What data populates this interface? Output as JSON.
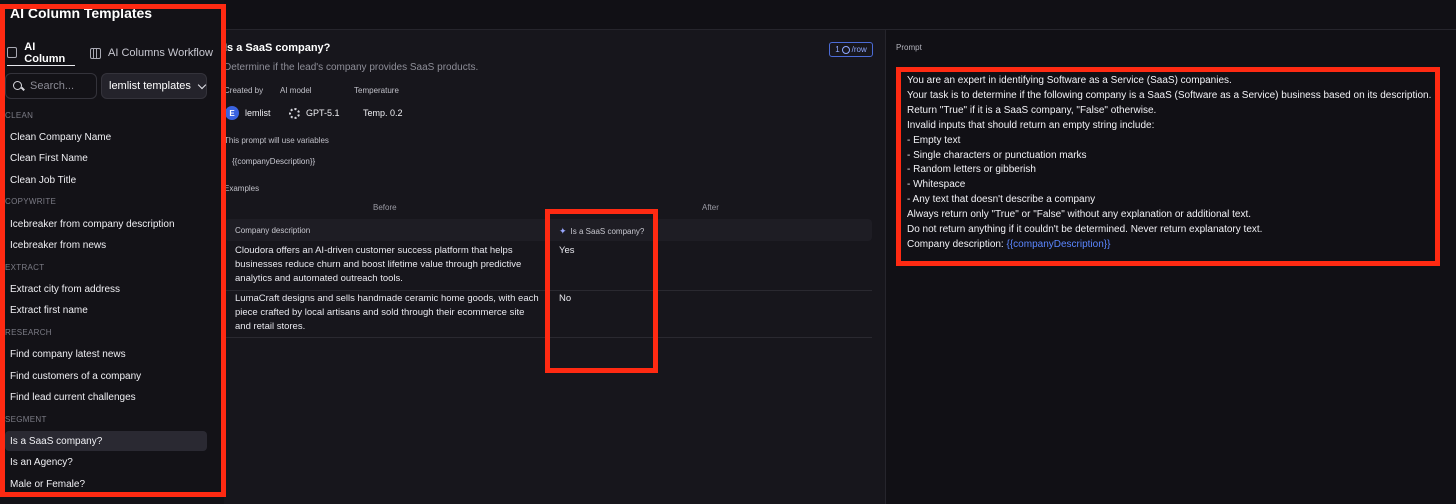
{
  "sidebar": {
    "title": "AI Column Templates",
    "tabs": [
      {
        "label": "AI Column",
        "icon": "document-icon",
        "active": true
      },
      {
        "label": "AI Columns Workflow",
        "icon": "columns-icon",
        "active": false
      }
    ],
    "search": {
      "placeholder": "Search...",
      "value": ""
    },
    "template_select": {
      "value": "lemlist templates"
    },
    "sections": [
      {
        "name": "CLEAN",
        "items": [
          "Clean Company Name",
          "Clean First Name",
          "Clean Job Title"
        ]
      },
      {
        "name": "COPYWRITE",
        "items": [
          "Icebreaker from company description",
          "Icebreaker from news"
        ]
      },
      {
        "name": "EXTRACT",
        "items": [
          "Extract city from address",
          "Extract first name"
        ]
      },
      {
        "name": "RESEARCH",
        "items": [
          "Find company latest news",
          "Find customers of a company",
          "Find lead current challenges"
        ]
      },
      {
        "name": "SEGMENT",
        "items": [
          "Is a SaaS company?",
          "Is an Agency?",
          "Male or Female?"
        ]
      }
    ],
    "selected_item": "Is a SaaS company?"
  },
  "main": {
    "title": "Is a SaaS company?",
    "subtitle": "Determine if the lead's company provides SaaS products.",
    "cost_badge": {
      "count": "1",
      "unit": "/row"
    },
    "meta": {
      "created_by_label": "Created by",
      "created_by": "lemlist",
      "avatar_letter": "E",
      "model_label": "AI model",
      "model": "GPT-5.1",
      "temperature_label": "Temperature",
      "temperature": "Temp. 0.2"
    },
    "variables_label": "This prompt will use variables",
    "variable": "{{companyDescription}}",
    "examples_label": "Examples",
    "before_label": "Before",
    "after_label": "After",
    "table": {
      "columns": [
        "Company description",
        "Is a SaaS company?"
      ],
      "rows": [
        {
          "description": "Cloudora offers an AI-driven customer success platform that helps businesses reduce churn and boost lifetime value through predictive analytics and automated outreach tools.",
          "result": "Yes"
        },
        {
          "description": "LumaCraft designs and sells handmade ceramic home goods, with each piece crafted by local artisans and sold through their ecommerce site and retail stores.",
          "result": "No"
        }
      ]
    }
  },
  "prompt": {
    "label": "Prompt",
    "lines": [
      "You are an expert in identifying Software as a Service (SaaS) companies.",
      "Your task is to determine if the following company is a SaaS (Software as a Service) business based on its description.",
      "Return \"True\" if it is a SaaS company, \"False\" otherwise.",
      "Invalid inputs that should return an empty string include:",
      "- Empty text",
      "- Single characters or punctuation marks",
      "- Random letters or gibberish",
      "- Whitespace",
      "- Any text that doesn't describe a company",
      "Always return only \"True\" or \"False\" without any explanation or additional text.",
      "Do not return anything if it couldn't be determined. Never return explanatory text."
    ],
    "last_line_prefix": "Company description: ",
    "last_line_variable": "{{companyDescription}}"
  },
  "colors": {
    "annotation_red": "#ff2a12",
    "variable_blue": "#5b86ff",
    "background": "#17161c"
  }
}
